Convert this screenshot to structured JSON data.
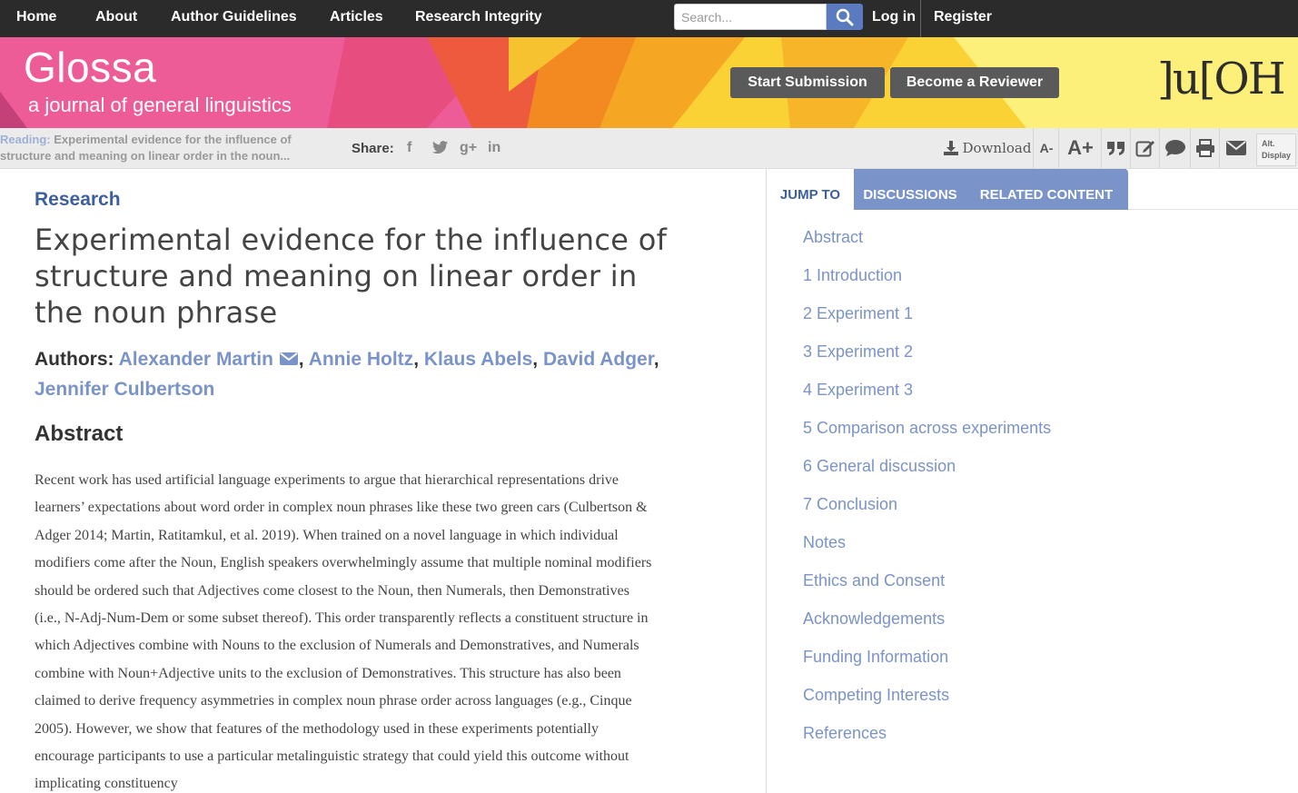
{
  "nav": {
    "links": [
      "Home",
      "About",
      "Author Guidelines",
      "Articles",
      "Research Integrity"
    ],
    "search_placeholder": "Search...",
    "login": "Log in",
    "register": "Register"
  },
  "banner": {
    "journal_name": "Glossa",
    "journal_subtitle": "a journal of general linguistics",
    "start_submission": "Start Submission",
    "become_reviewer": "Become a Reviewer",
    "logo_text": "]u[OH"
  },
  "toolbar": {
    "reading_label": "Reading:",
    "reading_line1": "Experimental evidence for the influence of",
    "reading_line2": "structure and meaning on linear order in the noun...",
    "share_label": "Share:",
    "download": "Download",
    "font_decrease": "A-",
    "font_increase": "A+",
    "alt_display_line1": "Alt.",
    "alt_display_line2": "Display"
  },
  "article": {
    "section": "Research",
    "title": "Experimental evidence for the influence of structure and meaning on linear order in the noun phrase",
    "authors_label": "Authors:",
    "authors": [
      "Alexander Martin",
      "Annie Holtz",
      "Klaus Abels",
      "David Adger",
      "Jennifer Culbertson"
    ],
    "abstract_heading": "Abstract",
    "abstract_text": "Recent work has used artificial language experiments to argue that hierarchical representations drive learners’ expectations about word order in complex noun phrases like these two green cars (Culbertson & Adger 2014; Martin, Ratitamkul, et al. 2019). When trained on a novel language in which individual modifiers come after the Noun, English speakers overwhelmingly assume that multiple nominal modifiers should be ordered such that Adjectives come closest to the Noun, then Numerals, then Demonstratives (i.e., N-Adj-Num-Dem or some subset thereof). This order transparently reflects a constituent structure in which Adjectives combine with Nouns to the exclusion of Numerals and Demonstratives, and Numerals combine with Noun+Adjective units to the exclusion of Demonstratives. This structure has also been claimed to derive frequency asymmetries in complex noun phrase order across languages (e.g., Cinque 2005). However, we show that features of the methodology used in these experiments potentially encourage participants to use a particular metalinguistic strategy that could yield this outcome without implicating constituency"
  },
  "sidebar": {
    "tabs": [
      "JUMP TO",
      "DISCUSSIONS",
      "RELATED CONTENT"
    ],
    "toc": [
      "Abstract",
      "1 Introduction",
      "2 Experiment 1",
      "3 Experiment 2",
      "4 Experiment 3",
      "5 Comparison across experiments",
      "6 General discussion",
      "7 Conclusion",
      "Notes",
      "Ethics and Consent",
      "Acknowledgements",
      "Funding Information",
      "Competing Interests",
      "References"
    ]
  },
  "colors": {
    "nav_bg": "#2b2b2b",
    "accent_blue": "#3d5fa0",
    "link_blue": "#7a93c9",
    "banner_pink": "#f05a97",
    "banner_yellow": "#fde84a"
  },
  "icons": {
    "search": "search-icon",
    "facebook": "facebook-icon",
    "twitter": "twitter-icon",
    "google_plus": "google-plus-icon",
    "linkedin": "linkedin-icon",
    "download": "download-icon",
    "cite": "quote-icon",
    "annotate": "edit-icon",
    "comments": "comment-icon",
    "print": "print-icon",
    "email": "envelope-icon"
  }
}
